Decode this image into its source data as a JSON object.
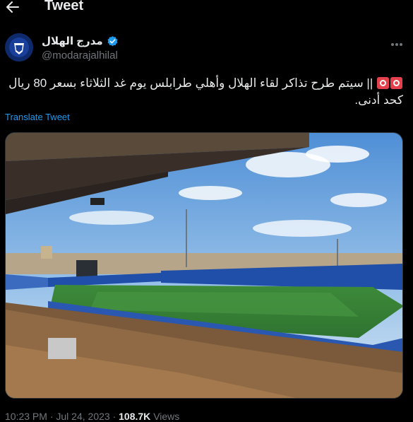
{
  "header": {
    "title": "Tweet"
  },
  "tweet": {
    "author": {
      "display_name": "مدرج الهلال",
      "handle": "@modarajalhilal"
    },
    "text_line1": "|| سيتم طرح تذاكر لقاء الهلال وأهلي طرابلس يوم غد الثلاثاء بسعر 80 ريال",
    "text_line2": "كحد أدنى.",
    "translate_label": "Translate Tweet",
    "time": "10:23 PM",
    "date": "Jul 24, 2023",
    "separator": "·",
    "views_count": "108.7K",
    "views_label": "Views"
  },
  "colors": {
    "background": "#000000",
    "text_primary": "#e7e9ea",
    "text_secondary": "#71767b",
    "link": "#1d9bf0",
    "verified": "#1d9bf0"
  },
  "icons": [
    "back-arrow-icon",
    "verified-badge-icon",
    "more-icon",
    "siren-emoji-icon"
  ]
}
